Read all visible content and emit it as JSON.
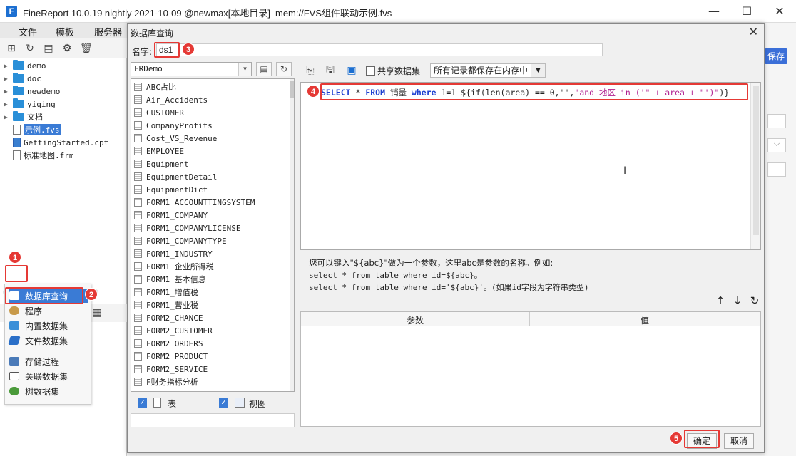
{
  "window": {
    "title": "FineReport 10.0.19 nightly 2021-10-09 @newmax[本地目录]",
    "file": "mem://FVS组件联动示例.fvs",
    "minimize": "—",
    "maximize": "☐",
    "close": "✕"
  },
  "menu": {
    "file": "文件",
    "template": "模板",
    "server": "服务器"
  },
  "tree": {
    "items": [
      {
        "label": "demo",
        "type": "folder"
      },
      {
        "label": "doc",
        "type": "folder"
      },
      {
        "label": "newdemo",
        "type": "folder"
      },
      {
        "label": "yiqing",
        "type": "folder"
      },
      {
        "label": "文档",
        "type": "folder"
      },
      {
        "label": "示例.fvs",
        "type": "file"
      },
      {
        "label": "GettingStarted.cpt",
        "type": "cpt"
      },
      {
        "label": "标准地图.frm",
        "type": "frm"
      }
    ]
  },
  "add_menu": {
    "items": [
      {
        "label": "数据库查询",
        "color": "#3a7bd5"
      },
      {
        "label": "程序",
        "color": "#c89a4a"
      },
      {
        "label": "内置数据集",
        "color": "#3a8fd8"
      },
      {
        "label": "文件数据集",
        "color": "#2a6fc8"
      },
      {
        "label": "存储过程",
        "color": "#4a7ab8"
      },
      {
        "label": "关联数据集",
        "color": "#555555"
      },
      {
        "label": "树数据集",
        "color": "#4a9a3a"
      }
    ]
  },
  "background": {
    "save_label": "保存",
    "dropdown_caret": "⌵"
  },
  "dialog": {
    "title": "数据库查询",
    "name_label": "名字:",
    "name_value": "ds1",
    "db_connection": "FRDemo",
    "tables": [
      "ABC占比",
      "Air_Accidents",
      "CUSTOMER",
      "CompanyProfits",
      "Cost_VS_Revenue",
      "EMPLOYEE",
      "Equipment",
      "EquipmentDetail",
      "EquipmentDict",
      "FORM1_ACCOUNTTINGSYSTEM",
      "FORM1_COMPANY",
      "FORM1_COMPANYLICENSE",
      "FORM1_COMPANYTYPE",
      "FORM1_INDUSTRY",
      "FORM1_企业所得税",
      "FORM1_基本信息",
      "FORM1_增值税",
      "FORM1_营业税",
      "FORM2_CHANCE",
      "FORM2_CUSTOMER",
      "FORM2_ORDERS",
      "FORM2_PRODUCT",
      "FORM2_SERVICE",
      "F财务指标分析"
    ],
    "table_checkbox_label": "表",
    "view_checkbox_label": "视图",
    "share_label": "共享数据集",
    "memory_option": "所有记录都保存在内存中",
    "sql": {
      "select": "SELECT",
      "star": " * ",
      "from": "FROM",
      "table": " 销量 ",
      "where": "where",
      "cond": " 1=1  ${if(len(area) == 0,\"\",",
      "str": "\"and 地区 in ('\" + area + \"')\"",
      "end": ")}"
    },
    "hint": {
      "line1": "您可以键入\"${abc}\"做为一个参数，这里abc是参数的名称。例如:",
      "line2": "select * from table where id=${abc}。",
      "line3": "select * from table where id='${abc}'。(如果id字段为字符串类型)"
    },
    "param_col": "参数",
    "value_col": "值",
    "ok": "确定",
    "cancel": "取消"
  },
  "badges": {
    "b1": "1",
    "b2": "2",
    "b3": "3",
    "b4": "4",
    "b5": "5"
  }
}
